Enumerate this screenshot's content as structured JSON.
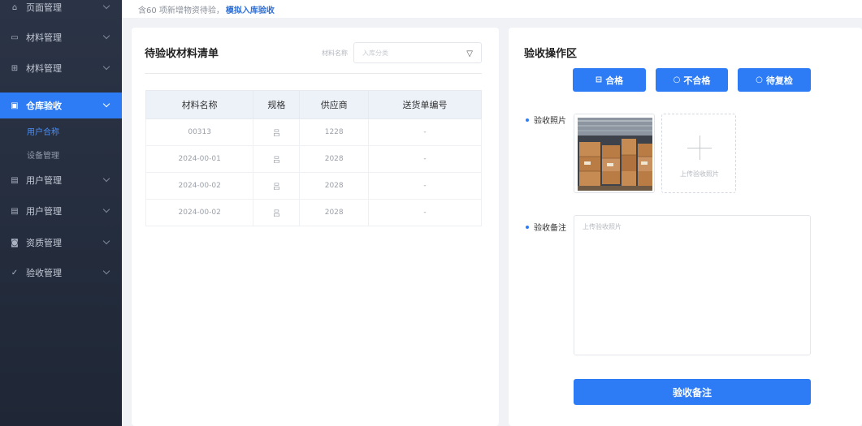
{
  "topbar": {
    "notice": "含60 项新增物资待验，",
    "link": "模拟入库验收"
  },
  "sidebar": {
    "items": [
      {
        "label": "页面管理",
        "icon": "home-icon"
      },
      {
        "label": "材料管理",
        "icon": "monitor-icon"
      },
      {
        "label": "材料管理",
        "icon": "grid-icon"
      },
      {
        "label": "仓库验收",
        "icon": "clipboard-icon"
      },
      {
        "label": "用户管理",
        "icon": "user-icon"
      },
      {
        "label": "用户管理",
        "icon": "user-icon"
      },
      {
        "label": "资质管理",
        "icon": "badge-icon"
      },
      {
        "label": "验收管理",
        "icon": "check-icon"
      }
    ],
    "subitems": [
      {
        "label": "用户合称"
      },
      {
        "label": "设备管理"
      }
    ]
  },
  "list_panel": {
    "title": "待验收材料清单",
    "filter_label": "材料名称",
    "filter_placeholder": "入库分类",
    "columns": [
      "材料名称",
      "规格",
      "供应商",
      "送货单编号"
    ],
    "rows": [
      [
        "00313",
        "吕",
        "1228",
        "-"
      ],
      [
        "2024-00-01",
        "吕",
        "2028",
        "-"
      ],
      [
        "2024-00-02",
        "吕",
        "2028",
        "-"
      ],
      [
        "2024-00-02",
        "吕",
        "2028",
        "-"
      ]
    ]
  },
  "action_panel": {
    "title": "验收操作区",
    "buttons": {
      "pass": "合格",
      "fail": "不合格",
      "recheck": "待复检"
    },
    "photo_label": "验收照片",
    "upload_text": "上传验收照片",
    "notes_label": "验收备注",
    "notes_placeholder": "上传验收照片",
    "submit": "验收备注"
  },
  "colors": {
    "primary": "#2d7cf6",
    "sidebar_bg": "#263042",
    "page_bg": "#f0f2f5"
  }
}
